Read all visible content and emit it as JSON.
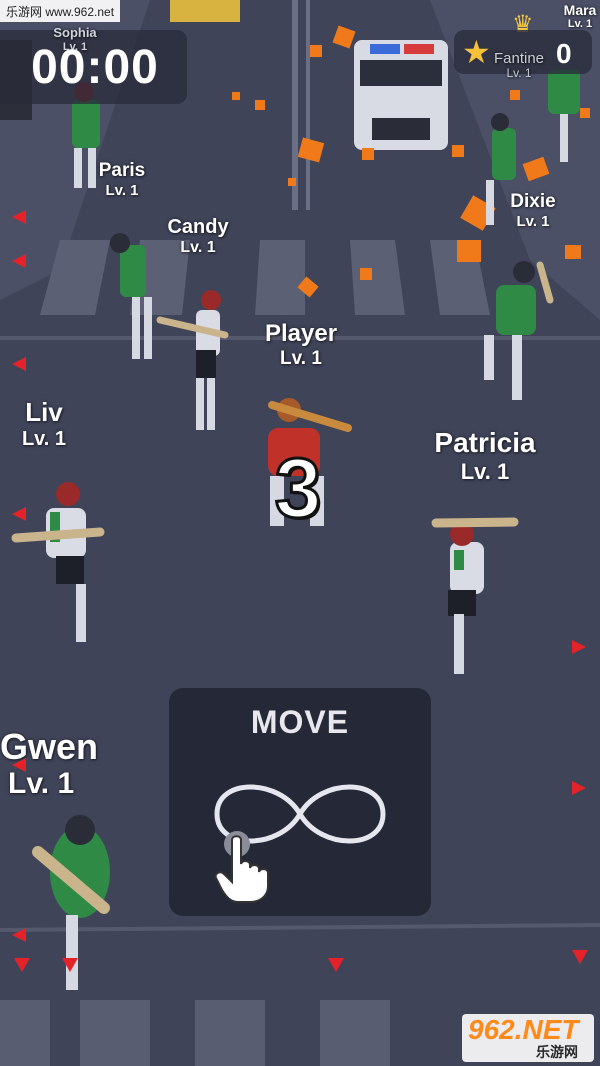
{
  "watermark_top": "乐游网 www.962.net",
  "watermark_bottom": {
    "big": "962.NET",
    "small": "乐游网"
  },
  "timer": "00:00",
  "score": {
    "name": "Fantine",
    "level": "Lv. 1",
    "value": "0"
  },
  "countdown": "3",
  "move_hint": {
    "title": "MOVE"
  },
  "players": [
    {
      "id": "sophia",
      "name": "Sophia",
      "level": "Lv. 1"
    },
    {
      "id": "mara",
      "name": "Mara",
      "level": "Lv. 1"
    },
    {
      "id": "paris",
      "name": "Paris",
      "level": "Lv. 1"
    },
    {
      "id": "candy",
      "name": "Candy",
      "level": "Lv. 1"
    },
    {
      "id": "dixie",
      "name": "Dixie",
      "level": "Lv. 1"
    },
    {
      "id": "player",
      "name": "Player",
      "level": "Lv. 1"
    },
    {
      "id": "liv",
      "name": "Liv",
      "level": "Lv. 1"
    },
    {
      "id": "patricia",
      "name": "Patricia",
      "level": "Lv. 1"
    },
    {
      "id": "gwen",
      "name": "Gwen",
      "level": "Lv. 1"
    }
  ],
  "colors": {
    "road": "#3f4459",
    "crosswalk": "#5b6075",
    "zombie_shirt": "#2f8a45",
    "player_shirt": "#c0312a",
    "bone": "#c9b48c",
    "debris": "#f07a1a",
    "indicator": "#e5222a"
  }
}
